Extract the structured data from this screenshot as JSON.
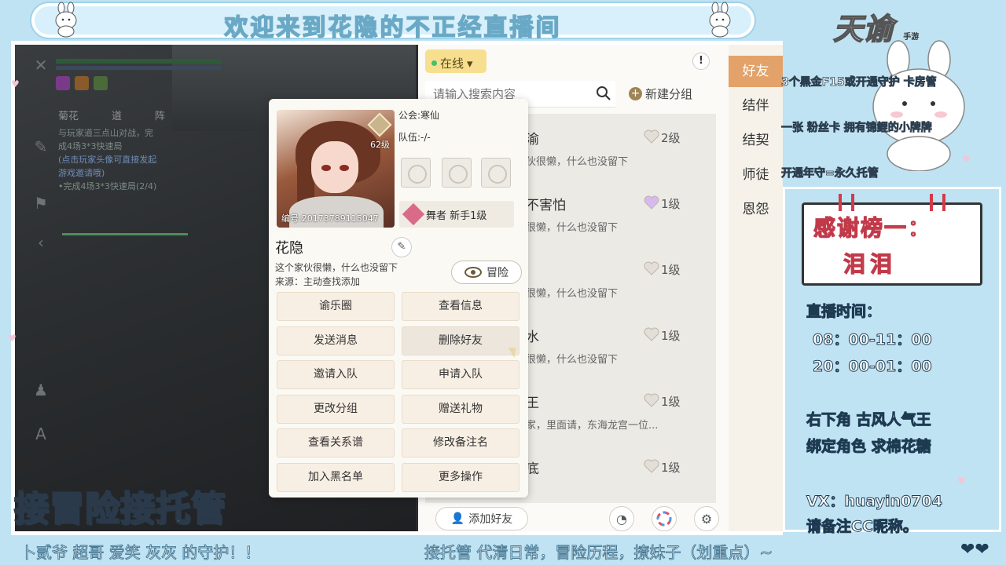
{
  "banner": {
    "title": "欢迎来到花隐的不正经直播间"
  },
  "game": {
    "tabs": [
      "菊花",
      "道",
      "阵"
    ],
    "quest_lines": [
      "与玩家道三点山对战，完",
      "成4场3*3快速局",
      "(点击玩家头像可直接发起",
      "游戏邀请哦)",
      "•完成4场3*3快速局(2/4)"
    ]
  },
  "friend_panel": {
    "online_status": "在线",
    "info_icon": "!",
    "search_placeholder": "请输入搜索内容",
    "new_group_label": "新建分组",
    "friends": [
      {
        "name": "渝",
        "signature": "伙很懒，什么也没留下",
        "level": "2级",
        "heart": "#e3dfd8"
      },
      {
        "name": "不害怕",
        "signature": "很懒，什么也没留下",
        "level": "1级",
        "heart": "#d8b9ef"
      },
      {
        "name": "",
        "signature": "很懒，什么也没留下",
        "level": "1级",
        "heart": "#e3dfd8"
      },
      {
        "name": "水",
        "signature": "很懒，什么也没留下",
        "level": "1级",
        "heart": "#e3dfd8"
      },
      {
        "name": "王",
        "signature": "家，里面请，东海龙宫一位...",
        "level": "1级",
        "heart": "#e3dfd8"
      },
      {
        "name": "底",
        "signature": "",
        "level": "1级",
        "heart": "#e3dfd8"
      }
    ],
    "add_friend_label": "添加好友"
  },
  "right_tabs": {
    "items": [
      "好友",
      "结伴",
      "结契",
      "师徒",
      "恩怨"
    ],
    "active_index": 0
  },
  "profile_card": {
    "guild": "公会:寒仙",
    "team": "队伍:-/-",
    "avatar_id": "编号:20173789115047",
    "avatar_level": "62级",
    "class_label": "舞者 新手1级",
    "name": "花隐",
    "signature": "这个家伙很懒，什么也没留下",
    "source": "来源：主动查找添加",
    "adventure_label": "冒险",
    "actions": [
      [
        "谕乐圈",
        "查看信息"
      ],
      [
        "发送消息",
        "删除好友"
      ],
      [
        "邀请入队",
        "申请入队"
      ],
      [
        "更改分组",
        "赠送礼物"
      ],
      [
        "查看关系谱",
        "修改备注名"
      ],
      [
        "加入黑名单",
        "更多操作"
      ]
    ]
  },
  "overlay": {
    "big_caption": "接冒险接托管",
    "ticker_left": "卜贰爷 超哥 爱笑 灰灰 的守护！！",
    "ticker_right": "接托管 代清日常，冒险历程，撩妹子（划重点）~",
    "logo": "天谕",
    "logo_sub": "手游",
    "side_lines": [
      "3个黑金F15或开通守护 卡房管",
      "一张 粉丝卡 拥有锦鲤的小牌牌",
      "开通年守=永久托管"
    ],
    "thanks_title": "感谢榜一：",
    "thanks_name": "泪泪",
    "live_time_label": "直播时间：",
    "live_time_1": "08：00-11：00",
    "live_time_2": "20：00-01：00",
    "promo_1": "右下角 古风人气王",
    "promo_2": "绑定角色 求棉花糖",
    "vx": "VX：huayin0704",
    "vx_note": "请备注CC昵称。"
  }
}
